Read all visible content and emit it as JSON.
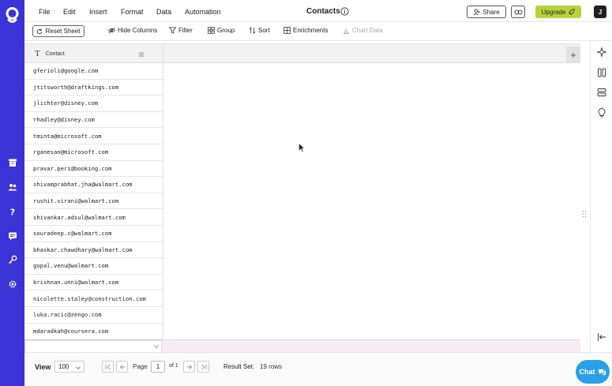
{
  "menu": {
    "items": [
      "File",
      "Edit",
      "Insert",
      "Format",
      "Data",
      "Automation"
    ],
    "title": "Contacts",
    "share_label": "Share",
    "upgrade_label": "Upgrade",
    "avatar_initial": "J"
  },
  "toolbar": {
    "reset_label": "Reset Sheet",
    "hide_columns_label": "Hide Columns",
    "filter_label": "Filter",
    "group_label": "Group",
    "sort_label": "Sort",
    "enrichments_label": "Enrichments",
    "chart_data_label": "Chart Data"
  },
  "grid": {
    "column_header": "Contact",
    "column_type_icon": "T",
    "rows": [
      "gferioli@google.com",
      "jtitsworth@draftkings.com",
      "jlichter@disney.com",
      "rhadley@disney.com",
      "tminta@microsoft.com",
      "rganesan@microsoft.com",
      "pravar.peri@booking.com",
      "shivamprabhat.jha@walmart.com",
      "rushit.virani@walmart.com",
      "shivankar.adsul@walmart.com",
      "souradeep.c@walmart.com",
      "bhaskar.chawdhary@walmart.com",
      "gopal.venu@walmart.com",
      "krishnan.unni@walmart.com",
      "nicolette.staley@construction.com",
      "luka.racic@zengo.com",
      "mdaradkah@coursera.com"
    ],
    "add_column_symbol": "+"
  },
  "status": {
    "view_label": "View",
    "page_size": "100",
    "page_label": "Page",
    "page_number": "1",
    "of_label": "of 1",
    "result_label": "Result Set:",
    "result_value": "19 rows"
  },
  "chat": {
    "label": "Chat"
  },
  "colors": {
    "rail": "#3b33d6",
    "upgrade": "#b7d33b",
    "chat": "#2aa0e8"
  }
}
